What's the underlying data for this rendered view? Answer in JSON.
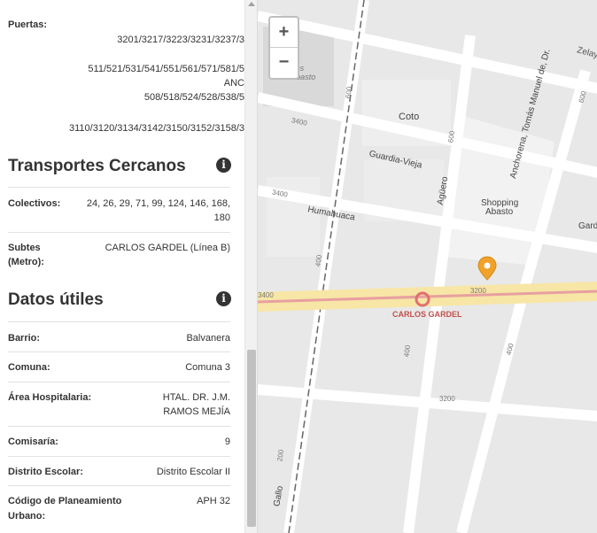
{
  "panel": {
    "puertas": {
      "label": "Puertas:",
      "lines": [
        "3201/3217/3223/3231/3237/3",
        "511/521/531/541/551/561/571/581/5",
        "ANC",
        "508/518/524/528/538/5",
        "3110/3120/3134/3142/3150/3152/3158/3"
      ]
    },
    "transportes": {
      "title": "Transportes Cercanos",
      "info_icon": "info-icon",
      "colectivos_label": "Colectivos:",
      "colectivos_value_1": "24, 26, 29, 71, 99, 124, 146, 168,",
      "colectivos_value_2": "180",
      "subtes_label_1": "Subtes",
      "subtes_label_2": "(Metro):",
      "subtes_value": "CARLOS GARDEL (Línea B)"
    },
    "datos": {
      "title": "Datos útiles",
      "info_icon": "info-icon",
      "rows": [
        {
          "label": "Barrio:",
          "value": "Balvanera"
        },
        {
          "label": "Comuna:",
          "value": "Comuna 3"
        },
        {
          "label": "Área Hospitalaria:",
          "value": "HTAL. DR. J.M.",
          "value2": "RAMOS MEJÍA"
        },
        {
          "label": "Comisaría:",
          "value": "9"
        },
        {
          "label": "Distrito Escolar:",
          "value": "Distrito Escolar II"
        },
        {
          "label": "Código de Planeamiento",
          "label2": "Urbano:",
          "value": "APH 32"
        }
      ]
    }
  },
  "map": {
    "zoom_in": "+",
    "zoom_out": "−",
    "streets": {
      "zelaya": "Zelaya",
      "guardia_vieja": "Guardia-Vieja",
      "humahuaca": "Humahuaca",
      "aguero": "Agüero",
      "anchorena": "Anchorena, Tomás Manuel de, Dr.",
      "gallo": "Gallo",
      "gard": "Gard"
    },
    "places": {
      "torres_1": "Torres",
      "torres_2": "de Abasto",
      "coto": "Coto",
      "shopping_1": "Shopping",
      "shopping_2": "Abasto"
    },
    "numbers": {
      "n3400_a": "3400",
      "n3400_b": "3400",
      "n3400_c": "3400",
      "n3200_a": "3200",
      "n3200_b": "3200",
      "n600_a": "600",
      "n600_b": "600",
      "n600_c": "600",
      "n400_a": "400",
      "n400_b": "400",
      "n400_c": "400",
      "n200": "200"
    },
    "station": "CARLOS GARDEL",
    "colors": {
      "avenue": "#f7e6a6",
      "avenue_line": "#e8a0a0",
      "pin": "#f0a22a",
      "station": "#e07070"
    }
  }
}
